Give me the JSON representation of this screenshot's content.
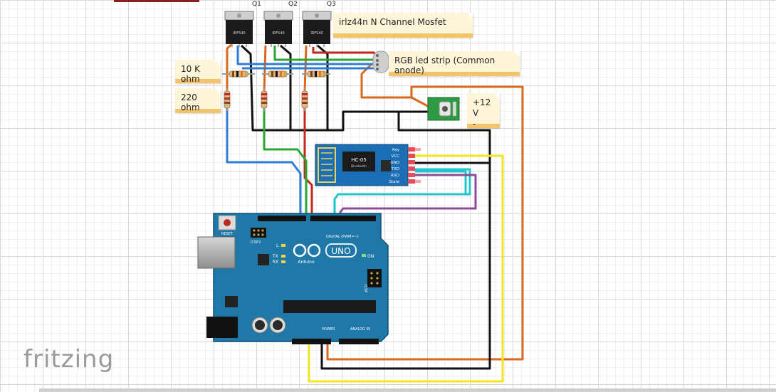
{
  "transistors": [
    {
      "ref": "Q1",
      "part": "IRF540"
    },
    {
      "ref": "Q2",
      "part": "IRF540"
    },
    {
      "ref": "Q3",
      "part": "IRF540"
    }
  ],
  "notes": {
    "mosfet": "irlz44n N Channel Mosfet",
    "ledstrip": "RGB led strip (Common anode)",
    "r10k": "10 K ohm",
    "r220": "220 ohm",
    "power_plus": "+12 V",
    "power_minus": "-"
  },
  "hc05": {
    "name": "HC-05",
    "sub": "Bluetooth",
    "pins": [
      "Key",
      "VCC",
      "GND",
      "TXD",
      "RXD",
      "State"
    ]
  },
  "arduino": {
    "brand": "Arduino",
    "model": "UNO",
    "reset": "RESET",
    "icsp2": "ICSP2",
    "icsp": "ICSP",
    "led_l": "L",
    "led_tx": "TX",
    "led_rx": "RX",
    "on": "ON",
    "digital": "DIGITAL (PWM=~)",
    "power": "POWER",
    "analog": "ANALOG IN"
  },
  "watermark": "fritzing",
  "colors": {
    "wire_black": "#111111",
    "wire_red": "#c0271e",
    "wire_green": "#29a830",
    "wire_blue": "#2f7bd6",
    "wire_orange": "#d9691e",
    "wire_yellow": "#f3e61d",
    "wire_cyan": "#20c6c9",
    "wire_purple": "#8e4a98",
    "arduino_blue": "#1f78a8",
    "hc05_blue": "#1c6fb5",
    "regulator_green": "#2f9a44"
  }
}
